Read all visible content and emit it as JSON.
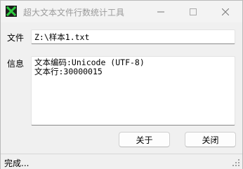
{
  "window": {
    "title": "超大文本文件行数统计工具",
    "icon": "app-x-logo-icon",
    "controls": [
      "minimize-icon",
      "maximize-icon",
      "close-icon"
    ]
  },
  "file": {
    "label": "文件",
    "value": "Z:\\样本1.txt"
  },
  "info": {
    "label": "信息",
    "lines": [
      "文本编码:Unicode (UTF-8)",
      "文本行:30000015"
    ]
  },
  "buttons": {
    "about": "关于",
    "close": "关闭"
  },
  "status": {
    "text": "完成..."
  },
  "colors": {
    "logo_green": "#1db954",
    "window_bg": "#f0f0f0",
    "title_text": "#9a9a9a"
  }
}
